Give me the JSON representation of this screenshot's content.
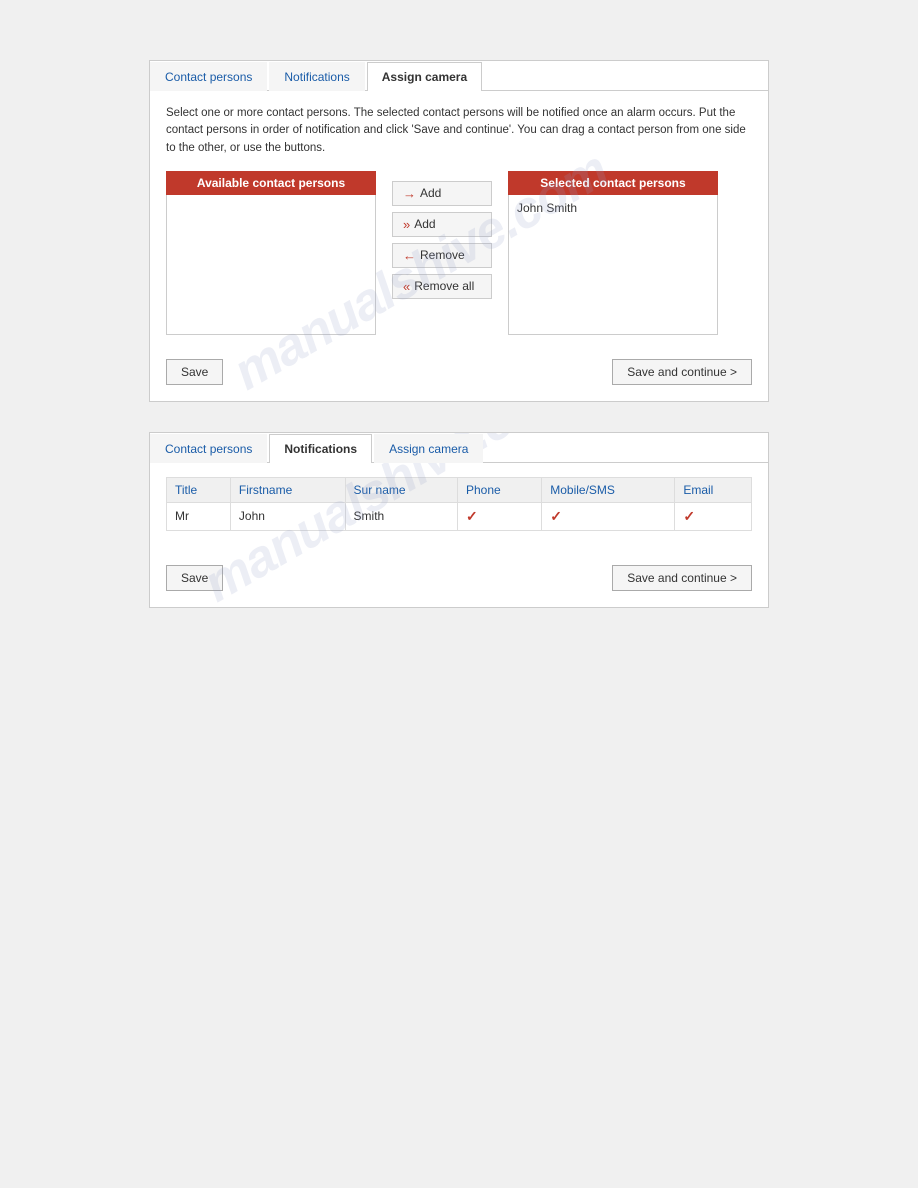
{
  "panel1": {
    "tabs": [
      {
        "label": "Contact persons",
        "active": false
      },
      {
        "label": "Notifications",
        "active": false
      },
      {
        "label": "Assign camera",
        "active": true
      }
    ],
    "description": "Select one or more contact persons. The selected contact persons will be notified once an alarm occurs. Put the contact persons in order of notification and click 'Save and continue'. You can drag a contact person from one side to the other, or use the buttons.",
    "available_header": "Available contact persons",
    "selected_header": "Selected contact persons",
    "selected_items": [
      "John Smith"
    ],
    "buttons": [
      {
        "label": "Add",
        "arrow": "→"
      },
      {
        "label": "Add",
        "arrow": "»"
      },
      {
        "label": "Remove",
        "arrow": "←"
      },
      {
        "label": "Remove all",
        "arrow": "«"
      }
    ],
    "save_label": "Save",
    "save_continue_label": "Save and continue >"
  },
  "panel2": {
    "tabs": [
      {
        "label": "Contact persons",
        "active": false
      },
      {
        "label": "Notifications",
        "active": true
      },
      {
        "label": "Assign camera",
        "active": false
      }
    ],
    "table": {
      "columns": [
        "Title",
        "Firstname",
        "Sur name",
        "Phone",
        "Mobile/SMS",
        "Email"
      ],
      "rows": [
        {
          "title": "Mr",
          "firstname": "John",
          "surname": "Smith",
          "phone": "✓",
          "mobile": "✓",
          "email": "✓"
        }
      ]
    },
    "save_label": "Save",
    "save_continue_label": "Save and continue >"
  },
  "watermark": "manualshive.com"
}
